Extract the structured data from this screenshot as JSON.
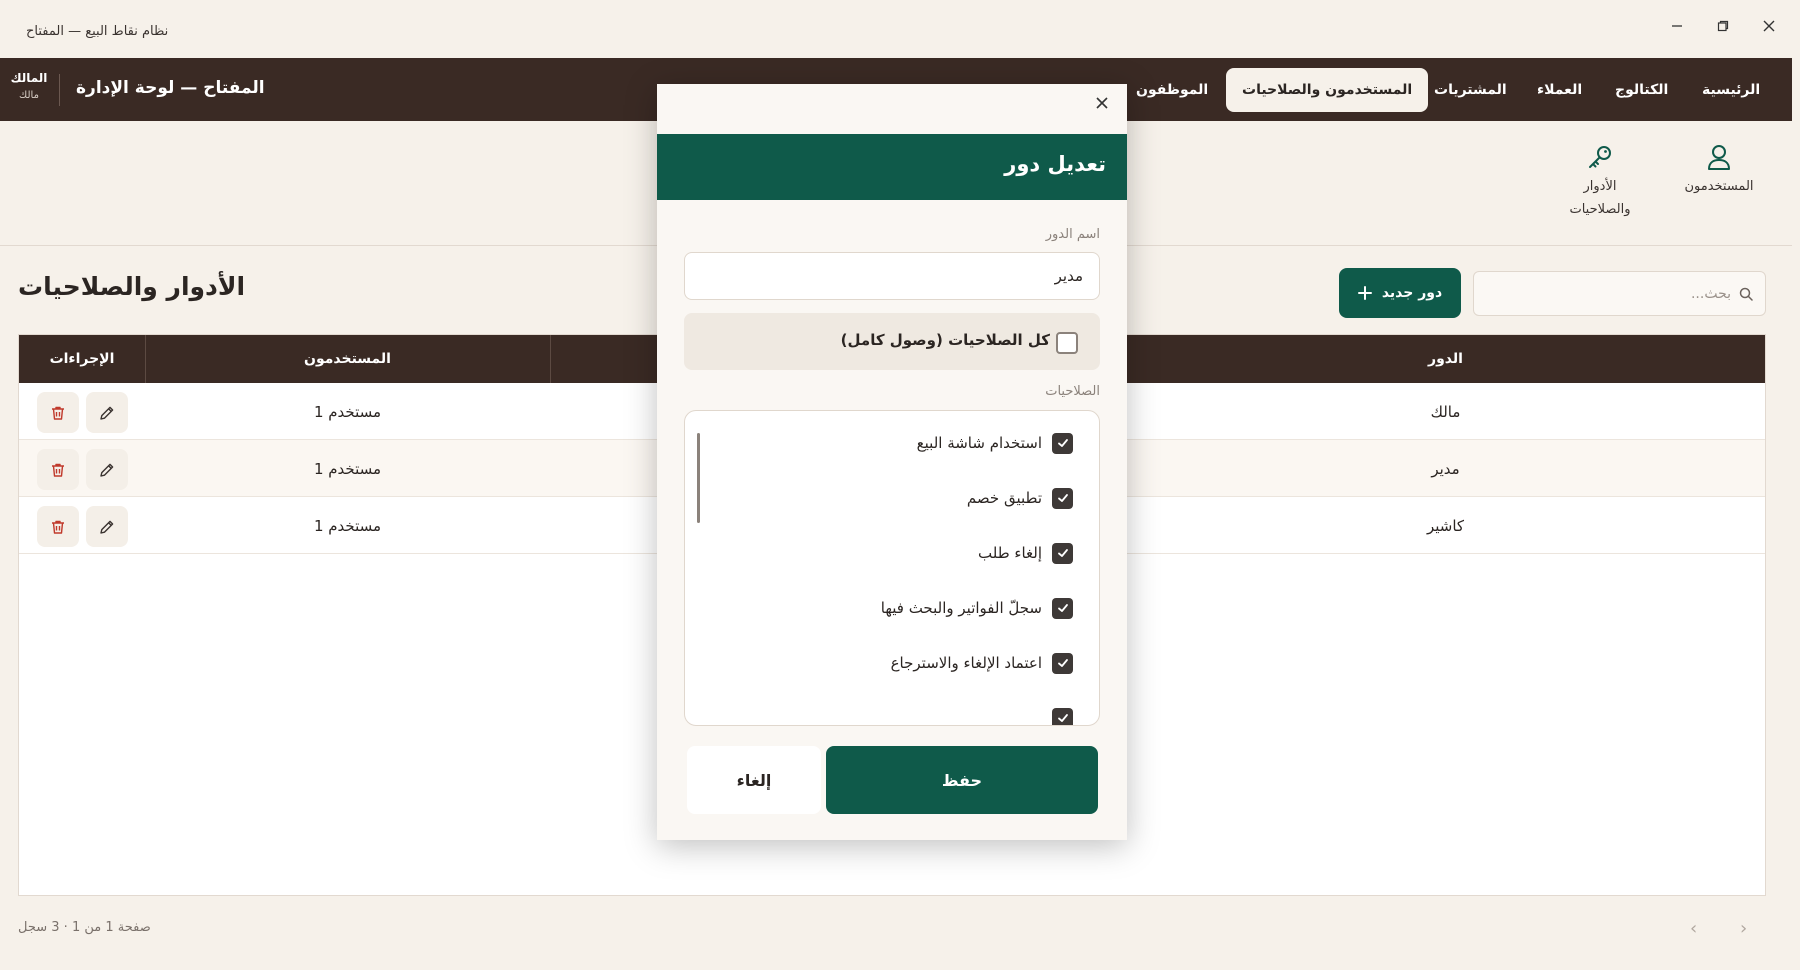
{
  "window": {
    "title": "نظام نقاط البيع — المفتاح"
  },
  "topnav": {
    "brand": "المفتاح — لوحة الإدارة",
    "user_name": "المالك",
    "user_role": "مالك",
    "tabs": [
      {
        "label": "الرئيسية",
        "icon": "home"
      },
      {
        "label": "الكتالوج",
        "icon": "catalog"
      },
      {
        "label": "العملاء",
        "icon": "customers"
      },
      {
        "label": "المشتريات",
        "icon": "purchases"
      },
      {
        "label": "المستخدمون والصلاحيات",
        "active": true
      },
      {
        "label": "الموظفون",
        "icon": "employees"
      }
    ]
  },
  "subnav": {
    "items": [
      {
        "label": "المستخدمون",
        "icon": "user-icon"
      },
      {
        "label": "الأدوار والصلاحيات",
        "icon": "key-icon"
      }
    ]
  },
  "page": {
    "title": "الأدوار والصلاحيات",
    "new_role_label": "دور جديد",
    "search_placeholder": "بحث..."
  },
  "table": {
    "columns": {
      "role": "الدور",
      "users": "المستخدمون",
      "actions": "الإجراءات"
    },
    "rows": [
      {
        "role": "مالك",
        "users": "1 مستخدم"
      },
      {
        "role": "مدير",
        "users": "1 مستخدم"
      },
      {
        "role": "كاشير",
        "users": "1 مستخدم"
      }
    ]
  },
  "pager": {
    "text": "صفحة 1 من 1 · 3 سجل"
  },
  "modal": {
    "title": "تعديل دور",
    "role_name_label": "اسم الدور",
    "role_name_value": "مدير",
    "all_permissions_label": "كل الصلاحيات (وصول كامل)",
    "all_permissions_checked": false,
    "permissions_label": "الصلاحيات",
    "permissions": [
      {
        "label": "استخدام شاشة البيع",
        "checked": true
      },
      {
        "label": "تطبيق خصم",
        "checked": true
      },
      {
        "label": "إلغاء طلب",
        "checked": true
      },
      {
        "label": "سجلّ الفواتير والبحث فيها",
        "checked": true
      },
      {
        "label": "اعتماد الإلغاء والاسترجاع",
        "checked": true
      }
    ],
    "save_label": "حفظ",
    "cancel_label": "إلغاء"
  },
  "colors": {
    "primary": "#0f5a4a",
    "nav": "#3a2a24",
    "background": "#f6f1ea",
    "danger": "#c0392b"
  }
}
